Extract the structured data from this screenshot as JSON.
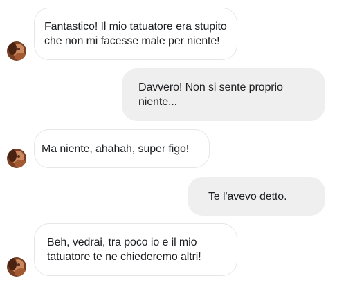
{
  "conversation": {
    "messages": [
      {
        "direction": "incoming",
        "text": "Fantastico! Il mio tatuatore era stupito\nche non mi facesse male per niente!"
      },
      {
        "direction": "outgoing",
        "text": "Davvero! Non si sente proprio\nniente..."
      },
      {
        "direction": "incoming",
        "text": "Ma niente, ahahah, super figo!"
      },
      {
        "direction": "outgoing",
        "text": "Te l'avevo detto."
      },
      {
        "direction": "incoming",
        "text": "Beh, vedrai, tra poco io e il mio\n tatuatore te ne chiederemo altri!"
      }
    ]
  },
  "colors": {
    "incoming_bubble": "#ffffff",
    "incoming_border": "#e6e6e6",
    "outgoing_bubble": "#efefef",
    "text": "#1c1e21",
    "avatar": "#8a4e2e"
  },
  "icons": {
    "avatar": "contact-avatar-photo"
  }
}
